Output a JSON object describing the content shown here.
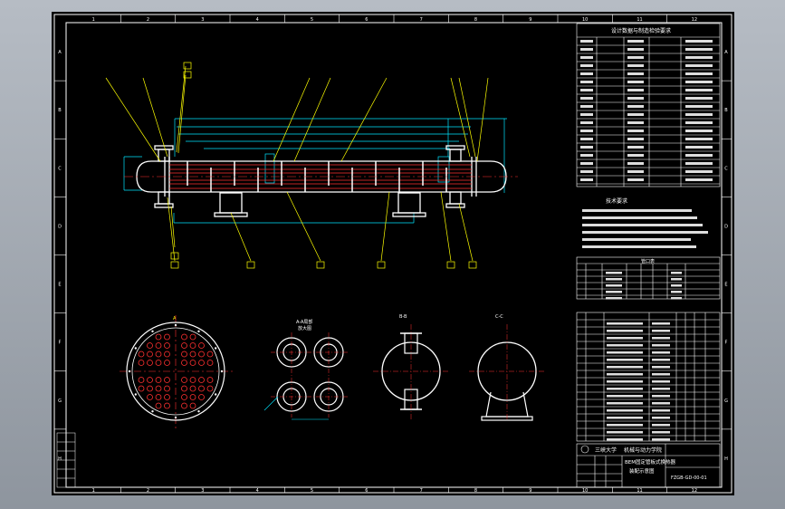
{
  "title_block": {
    "school": "三峡大学",
    "college": "机械与动力学院",
    "part_name": "BEM固定管板式换热器",
    "part_subtitle": "装配示意图",
    "drawing_no": "FZGB-GD-00-01"
  },
  "top_table": {
    "title": "设计数据与制造检验要求"
  },
  "tech_req": {
    "title": "技术要求"
  },
  "nozzle_table": {
    "title": "管口表"
  },
  "views": {
    "tube_sheet_label": "A",
    "bundle_label": "A-A局部\n放大图",
    "section1_label": "B-B",
    "section2_label": "C-C"
  },
  "grid": {
    "columns": [
      "1",
      "2",
      "3",
      "4",
      "5",
      "6",
      "7",
      "8",
      "9",
      "10",
      "11",
      "12"
    ],
    "rows": [
      "A",
      "B",
      "C",
      "D",
      "E",
      "F",
      "G",
      "H"
    ]
  },
  "colors": {
    "background": "#000000",
    "border": "#ffffff",
    "dimension": "#00e5ff",
    "leader": "#ffff00",
    "tube": "#ff3030",
    "centerline": "#ff3030"
  }
}
